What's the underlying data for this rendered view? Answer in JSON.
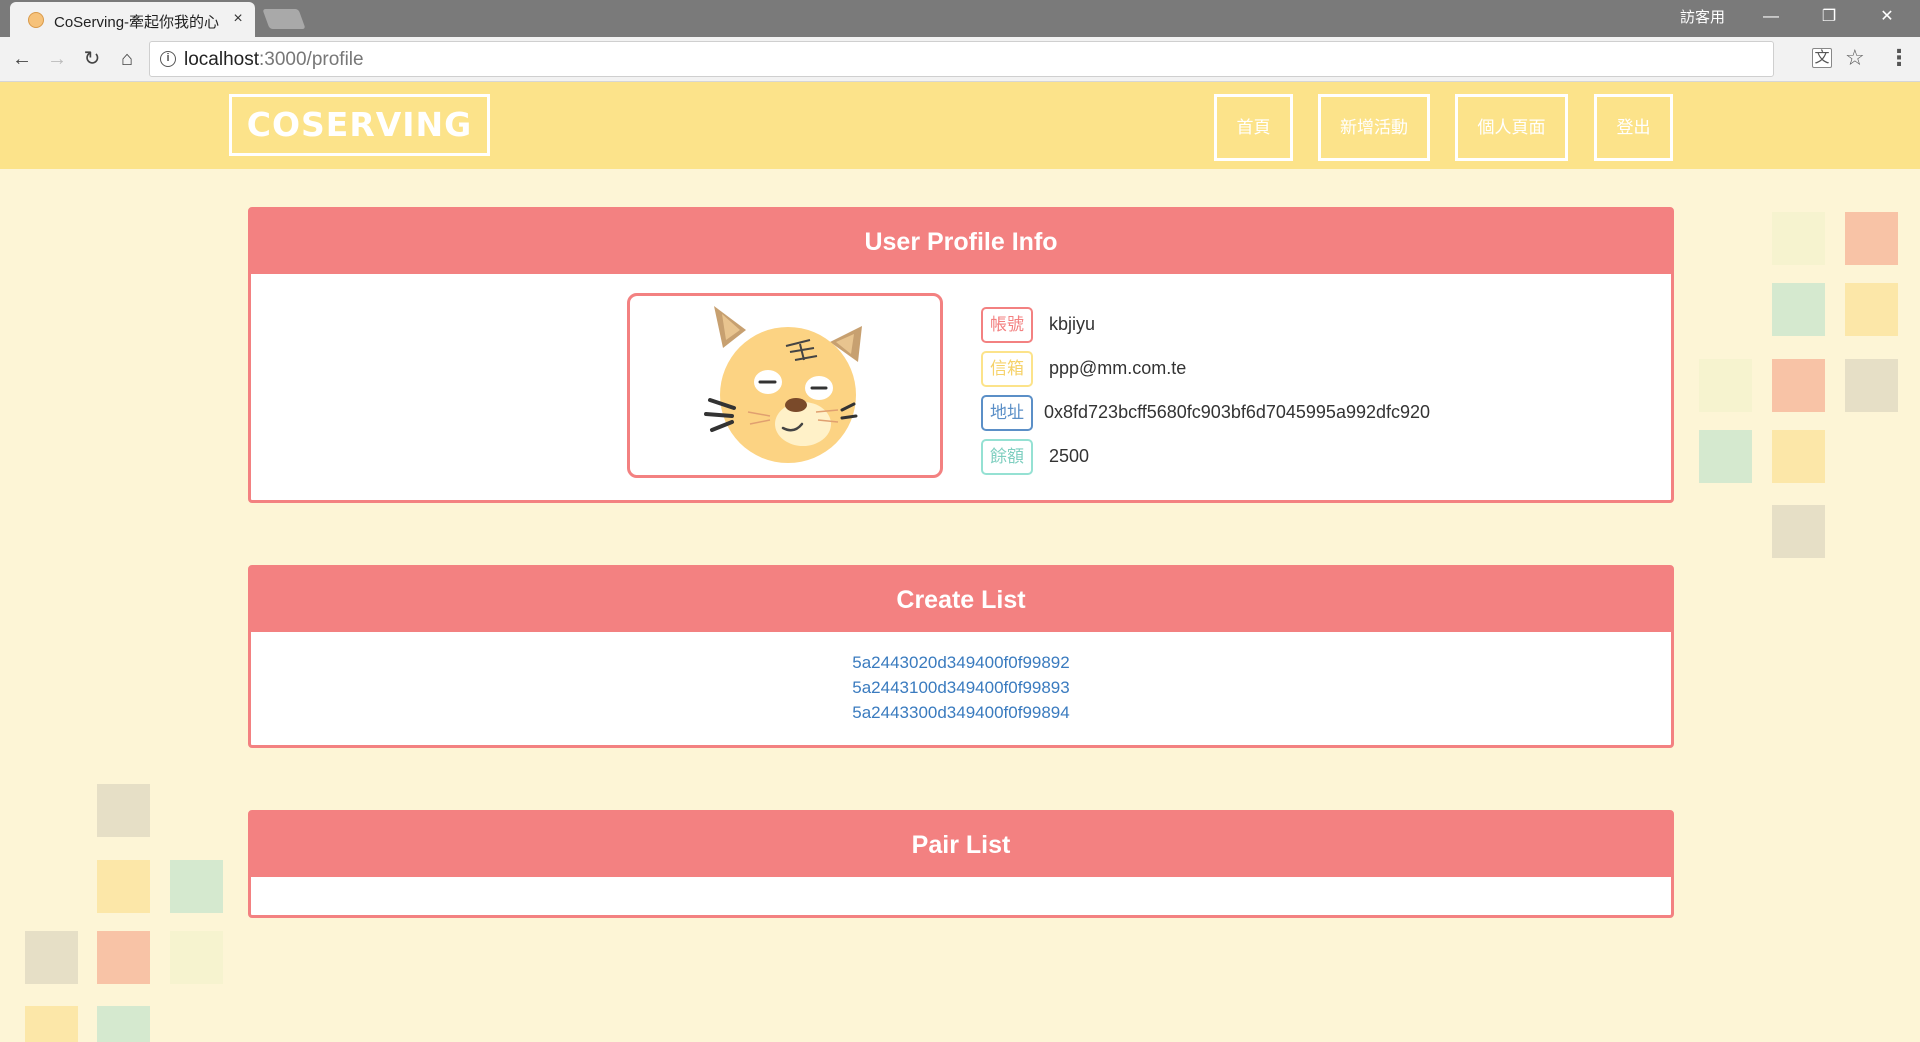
{
  "browser": {
    "tab_title": "CoServing-牽起你我的心",
    "tab_close": "×",
    "guest_label": "訪客用",
    "url_host": "localhost",
    "url_path": ":3000/profile"
  },
  "header": {
    "logo": "COSERVING",
    "nav": [
      {
        "label": "首頁"
      },
      {
        "label": "新增活動"
      },
      {
        "label": "個人頁面"
      },
      {
        "label": "登出"
      }
    ]
  },
  "profile": {
    "title": "User Profile Info",
    "fields": [
      {
        "tag": "帳號",
        "value": "kbjiyu",
        "color": "#f38181"
      },
      {
        "tag": "信箱",
        "value": "ppp@mm.com.te",
        "color": "#fce38a"
      },
      {
        "tag": "地址",
        "value": "0x8fd723bcff5680fc903bf6d7045995a992dfc920",
        "color": "#5b8fc7"
      },
      {
        "tag": "餘額",
        "value": "2500",
        "color": "#95e1d3"
      }
    ]
  },
  "create_list": {
    "title": "Create List",
    "items": [
      "5a2443020d349400f0f99892",
      "5a2443100d349400f0f99893",
      "5a2443300d349400f0f99894"
    ]
  },
  "pair_list": {
    "title": "Pair List",
    "items": []
  },
  "colors": {
    "accent": "#f38181",
    "header_bg": "#fce38a",
    "page_bg": "#fdf5d6"
  }
}
